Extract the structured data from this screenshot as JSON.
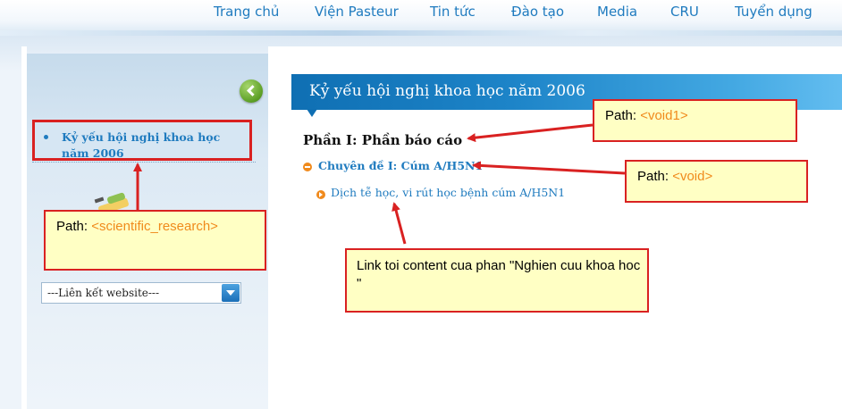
{
  "nav": {
    "items": [
      "Trang chủ",
      "Viện Pasteur",
      "Tin tức",
      "Đào tạo",
      "Media",
      "CRU",
      "Tuyển dụng"
    ]
  },
  "sidebar": {
    "active_link": "Kỷ yếu hội nghị khoa học năm 2006",
    "website_select": "---Liên kết website---"
  },
  "main": {
    "header_title": "Kỷ yếu hội nghị khoa học năm 2006",
    "section_title": "Phần I: Phần báo cáo",
    "topic_label": "Chuyên đề I: Cúm A/H5N1",
    "article_label": "Dịch tễ học, vi rút học bệnh cúm A/H5N1"
  },
  "annotations": {
    "void1": {
      "prefix": "Path: ",
      "path": "<void1>"
    },
    "void": {
      "prefix": "Path: ",
      "path": "<void>"
    },
    "scientific_research": {
      "prefix": "Path: ",
      "path": "<scientific_research>"
    },
    "link_note": "Link toi content cua phan \"Nghien cuu khoa hoc \""
  },
  "colors": {
    "link_blue": "#1f7bbf",
    "header_blue": "#1d84c8",
    "annotation_red": "#d92121",
    "annotation_orange": "#f08a1c",
    "note_yellow": "#ffffc4"
  }
}
